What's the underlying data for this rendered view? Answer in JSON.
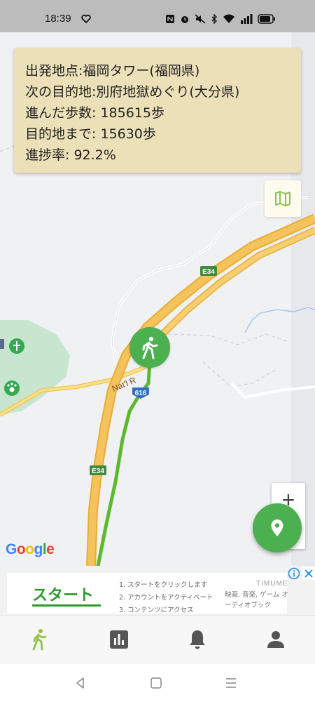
{
  "status_bar": {
    "time": "18:39",
    "icons": [
      "heart-icon",
      "nfc-icon",
      "alarm-icon",
      "mute-icon",
      "bluetooth-icon",
      "wifi-icon",
      "signal-icon",
      "battery-icon"
    ]
  },
  "info_card": {
    "start_label": "出発地点:福岡タワー(福岡県)",
    "next_label": "次の目的地:別府地獄めぐり(大分県)",
    "steps_label": "進んだ歩数: 185615歩",
    "remaining_label": "目的地まで: 15630歩",
    "progress_label": "進捗率: 92.2%"
  },
  "map": {
    "road_labels": {
      "e34_upper": "E34",
      "e34_lower": "E34",
      "route_616": "616",
      "natl_road": "Nat'l R"
    },
    "zoom_in_label": "+",
    "google_logo": [
      "G",
      "o",
      "o",
      "g",
      "l",
      "e"
    ],
    "google_colors": [
      "#4285f4",
      "#ea4335",
      "#fbbc05",
      "#4285f4",
      "#34a853",
      "#ea4335"
    ],
    "route_color": "#5cb82d",
    "highway_color": "#f5c35b"
  },
  "ad": {
    "cta": "スタート",
    "steps": [
      "1. スタートをクリックします",
      "2. アカウントをアクティベート",
      "3. コンテンツにアクセス"
    ],
    "brand": "TIMUME",
    "description": "映画, 音楽, ゲーム オーディオブック"
  },
  "bottom_nav": {
    "items": [
      "walk-icon",
      "stats-icon",
      "notifications-icon",
      "profile-icon"
    ],
    "active_color": "#8bc34a",
    "inactive_color": "#555555"
  },
  "colors": {
    "accent": "#4caf50",
    "card_bg": "#ece0b8"
  }
}
